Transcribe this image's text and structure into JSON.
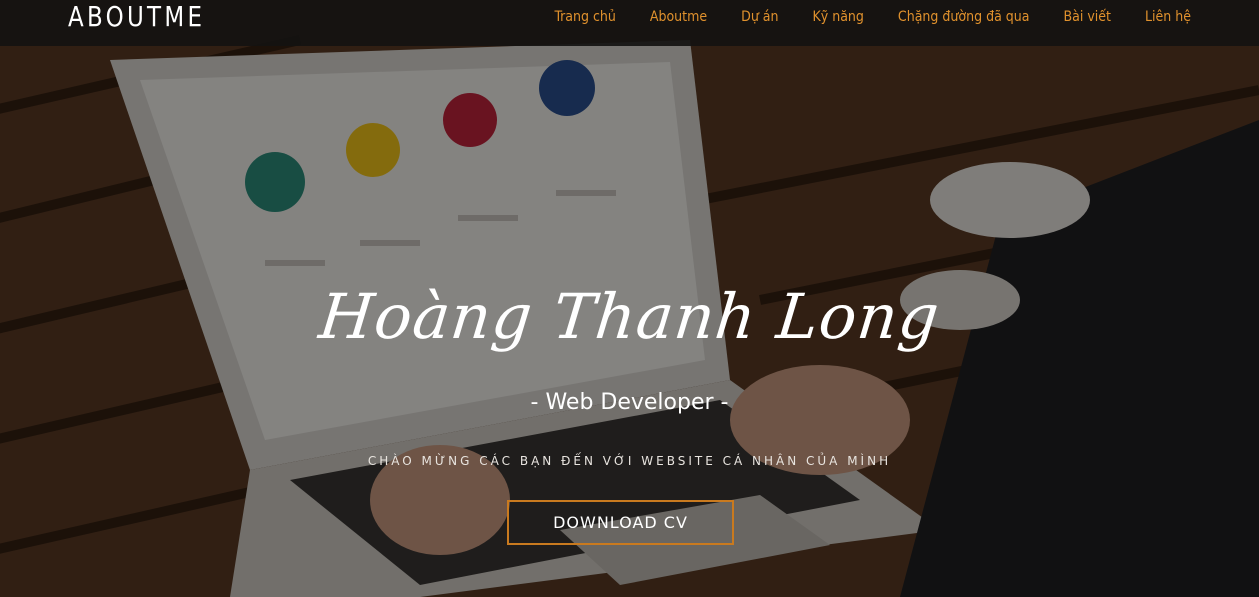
{
  "navbar": {
    "brand": "ABOUTME",
    "menu": [
      {
        "label": "Trang chủ"
      },
      {
        "label": "Aboutme"
      },
      {
        "label": "Dự án"
      },
      {
        "label": "Kỹ năng"
      },
      {
        "label": "Chặng đường đã qua"
      },
      {
        "label": "Bài viết"
      },
      {
        "label": "Liên hệ"
      }
    ],
    "accent_color": "#e0912d"
  },
  "hero": {
    "name": "Hoàng Thanh Long",
    "role": "- Web Developer -",
    "welcome": "CHÀO MỪNG CÁC BẠN ĐẾN VỚI WEBSITE CÁ NHÂN CỦA MÌNH",
    "cta_label": "DOWNLOAD CV",
    "cta_border_color": "#c97a1f"
  }
}
